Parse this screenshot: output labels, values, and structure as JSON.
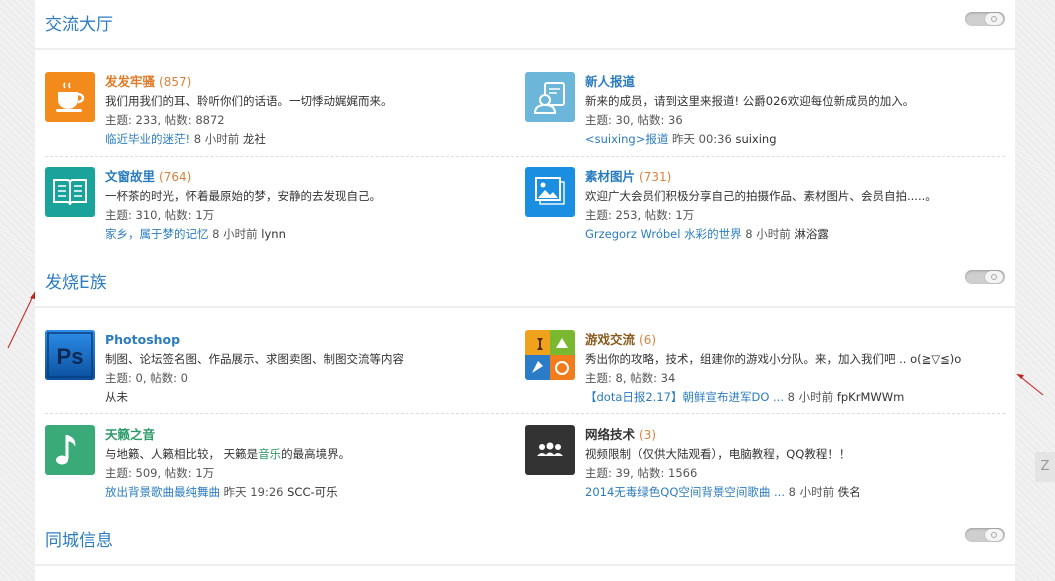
{
  "colors": {
    "accent": "#2b7cc0",
    "count": "#d9823a",
    "orange": "#f39c1f",
    "teal": "#1aa39a",
    "lightblue": "#6bb6d9",
    "blue": "#1a8ee0",
    "psblue": "#0e5fb5",
    "green": "#3aaa78",
    "dark": "#333333"
  },
  "sections": [
    {
      "title": "交流大厅",
      "forums": [
        {
          "name": "发发牢骚",
          "name_color": "#e07b2a",
          "count": "(857)",
          "desc": "我们用我们的耳、聆听你们的话语。一切悸动娓娓而来。",
          "stats": "主题: 233, 帖数: 8872",
          "last_title": "临近毕业的迷茫!",
          "last_time": " 8 小时前 ",
          "last_user": "龙社",
          "icon": "cup-icon"
        },
        {
          "name": "新人报道",
          "name_color": "#2b7cc0",
          "count": "",
          "desc": "新来的成员，请到这里来报道!  公爵026欢迎每位新成员的加入。",
          "stats": "主题: 30, 帖数: 36",
          "last_title": "<suixing>报道",
          "last_time": " 昨天 00:36 ",
          "last_user": "suixing",
          "icon": "user-card-icon"
        },
        {
          "name": "文窗故里",
          "name_color": "#2b7cc0",
          "count": "(764)",
          "desc": "一杯茶的时光，怀着最原始的梦，安静的去发现自己。",
          "stats": "主题: 310, 帖数: 1万",
          "last_title": "家乡，属于梦的记忆",
          "last_time": " 8 小时前 ",
          "last_user": "lynn",
          "icon": "book-icon"
        },
        {
          "name": "素材图片",
          "name_color": "#2b7cc0",
          "count": "(731)",
          "desc": "欢迎广大会员们积极分享自己的拍摄作品、素材图片、会员自拍.....。",
          "stats": "主题: 253, 帖数: 1万",
          "last_title": "Grzegorz Wróbel 水彩的世界",
          "last_time": " 8 小时前 ",
          "last_user": "淋浴露",
          "icon": "picture-icon"
        }
      ]
    },
    {
      "title": "发烧E族",
      "forums": [
        {
          "name": "Photoshop",
          "name_color": "#2b7cc0",
          "count": "",
          "desc": "制图、论坛签名图、作品展示、求图卖图、制图交流等内容",
          "stats": "主题: 0, 帖数: 0",
          "last_title": "",
          "last_time": "",
          "last_user": "从未",
          "icon": "photoshop-icon",
          "ps_text": "Ps"
        },
        {
          "name": "游戏交流",
          "name_color": "#8a5a1c",
          "count": "(6)",
          "desc": "秀出你的攻略，技术，组建你的游戏小分队。来，加入我们吧 .. o(≧▽≦)o",
          "stats": "主题: 8, 帖数: 34",
          "last_title": "【dota日报2.17】朝鲜宣布进军DO ...",
          "last_time": " 8 小时前 ",
          "last_user": "fpKrMWWm",
          "icon": "game-icon"
        },
        {
          "name": "天籁之音",
          "name_color": "#2b9b6a",
          "count": "",
          "desc_parts": [
            "与地籁、人籁相比较，  天籁是",
            "音乐",
            "的最高境界。"
          ],
          "stats": "主题: 509, 帖数: 1万",
          "last_title": "放出背景歌曲最纯舞曲",
          "last_time": " 昨天 19:26 ",
          "last_user": "SCC-可乐",
          "icon": "music-note-icon"
        },
        {
          "name": "网络技术",
          "name_color": "#333333",
          "count": "(3)",
          "desc": "视频限制（仅供大陆观看），电脑教程，QQ教程！！",
          "stats": "主题: 39, 帖数: 1566",
          "last_title": "2014无毒绿色QQ空间背景空间歌曲 ...",
          "last_time": " 8 小时前 ",
          "last_user": "佚名",
          "icon": "group-icon"
        }
      ]
    },
    {
      "title": "同城信息",
      "forums": []
    }
  ],
  "side_tab": "Z"
}
